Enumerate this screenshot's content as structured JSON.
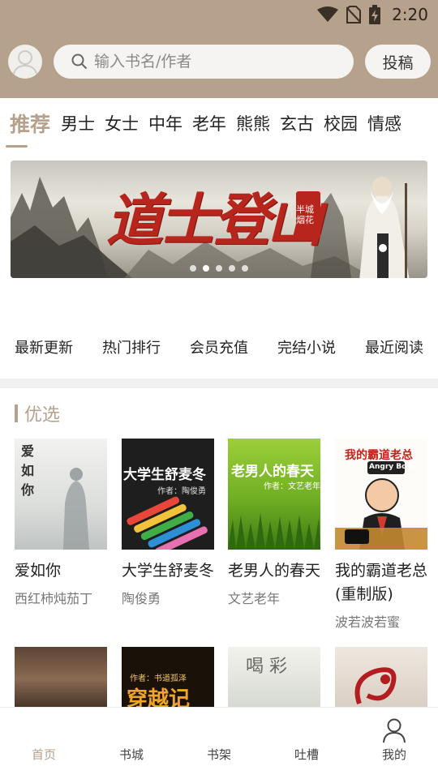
{
  "status_bar": {
    "time": "2:20",
    "icons": [
      "wifi-icon",
      "no-sim-icon",
      "battery-charging-icon"
    ]
  },
  "header": {
    "avatar_icon": "user-avatar-icon",
    "search_placeholder": "输入书名/作者",
    "search_value": "",
    "submit_label": "投稿",
    "background_color": "#b5a18c"
  },
  "tabs": [
    {
      "label": "推荐",
      "active": true
    },
    {
      "label": "男士"
    },
    {
      "label": "女士"
    },
    {
      "label": "中年"
    },
    {
      "label": "老年"
    },
    {
      "label": "熊熊"
    },
    {
      "label": "玄古"
    },
    {
      "label": "校园"
    },
    {
      "label": "情感"
    }
  ],
  "banner": {
    "title": "道士登山",
    "seal_text": "半城烟花",
    "dots": 5,
    "active_dot": 1
  },
  "quick_links": [
    "最新更新",
    "热门排行",
    "会员充值",
    "完结小说",
    "最近阅读"
  ],
  "featured": {
    "title": "优选",
    "books": [
      {
        "title": "爱如你",
        "author": "西红柿炖茄丁",
        "cover_text": "爱\n如\n你"
      },
      {
        "title": "大学生舒麦冬",
        "author": "陶俊勇",
        "cover_text": "大学生舒麦冬",
        "cover_sub": "作者：陶俊勇"
      },
      {
        "title": "老男人的春天",
        "author": "文艺老年",
        "cover_text": "老男人的春天",
        "cover_sub": "作者：文艺老年"
      },
      {
        "title": "我的霸道老总(重制版)",
        "author": "波若波若蜜",
        "cover_text": "我的霸道老总",
        "cover_sub": "Angry Boss"
      }
    ],
    "row2_covers": [
      {
        "cover_text": ""
      },
      {
        "cover_text": "穿越记",
        "cover_sub": "作者：书道孤泽"
      },
      {
        "cover_text": "喝 彩"
      },
      {
        "cover_text": ""
      }
    ]
  },
  "bottom_nav": [
    {
      "label": "首页",
      "active": true
    },
    {
      "label": "书城"
    },
    {
      "label": "书架"
    },
    {
      "label": "吐槽"
    },
    {
      "label": "我的",
      "icon": "person-icon"
    }
  ],
  "colors": {
    "accent": "#b5a18c",
    "banner_red": "#b8251c"
  }
}
